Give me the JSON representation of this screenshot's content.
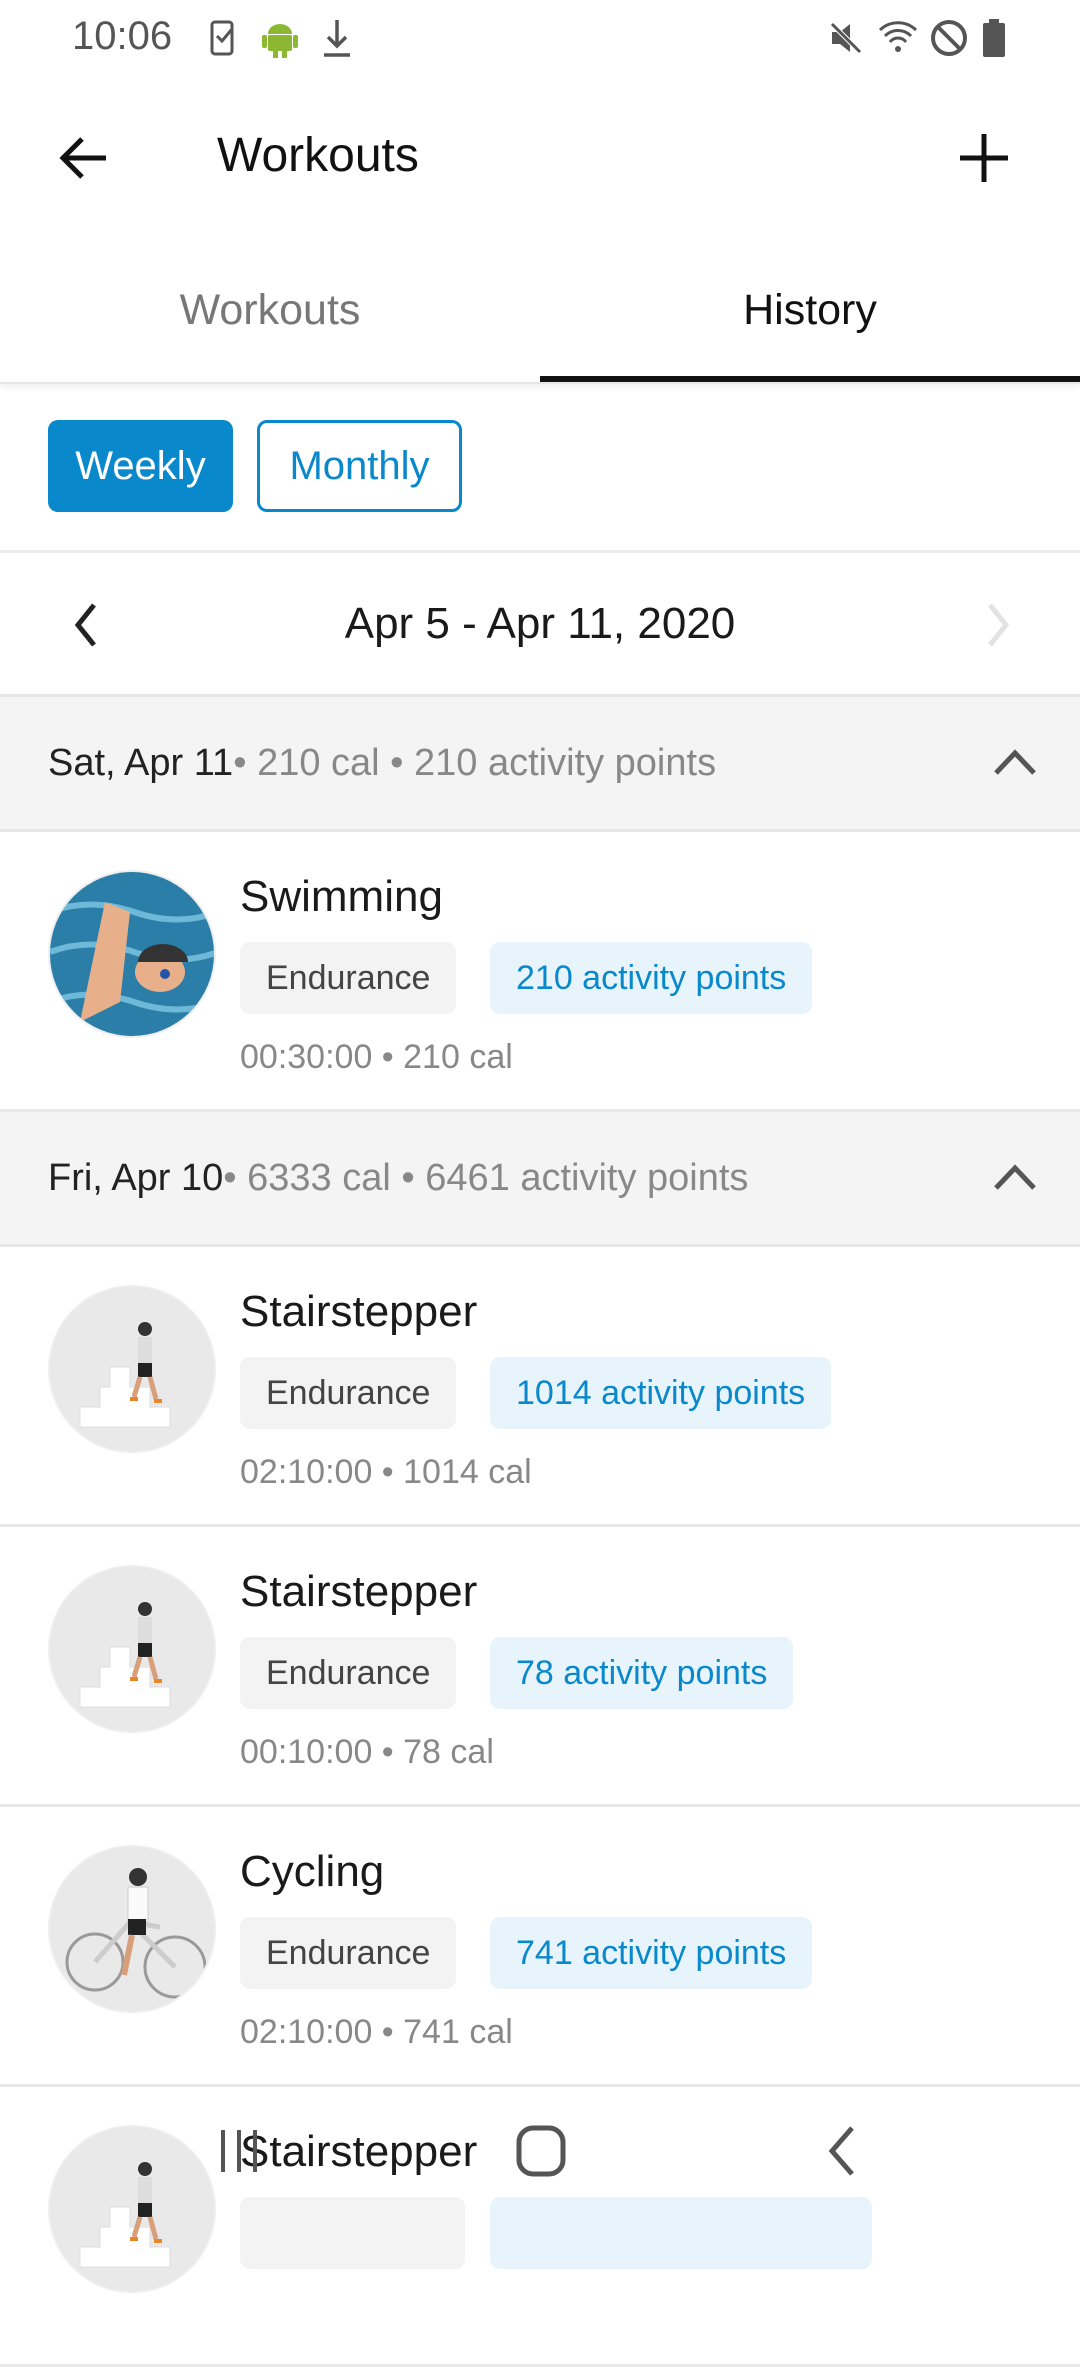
{
  "status_bar": {
    "time": "10:06",
    "icons": [
      "task-check-icon",
      "android-icon",
      "download-icon",
      "mute-icon",
      "wifi-icon",
      "do-not-disturb-icon",
      "battery-icon"
    ]
  },
  "toolbar": {
    "title": "Workouts",
    "back_icon": "arrow-left-icon",
    "add_icon": "plus-icon"
  },
  "tabs": [
    {
      "label": "Workouts",
      "active": false
    },
    {
      "label": "History",
      "active": true
    }
  ],
  "period": {
    "options": [
      "Weekly",
      "Monthly"
    ],
    "selected": "Weekly"
  },
  "date_range": {
    "label": "Apr 5 - Apr 11, 2020",
    "next_enabled": false
  },
  "colors": {
    "accent": "#0a88cc",
    "chip_bg": "#e8f4fb"
  },
  "days": [
    {
      "date": "Sat, Apr 11",
      "summary": " • 210 cal • 210 activity points",
      "items": [
        {
          "name": "Swimming",
          "type": "Endurance",
          "points": "210 activity points",
          "detail": "00:30:00 • 210 cal",
          "image": "swimming"
        }
      ]
    },
    {
      "date": "Fri, Apr 10",
      "summary": " • 6333 cal • 6461 activity points",
      "items": [
        {
          "name": "Stairstepper",
          "type": "Endurance",
          "points": "1014 activity points",
          "detail": "02:10:00 • 1014 cal",
          "image": "stairs"
        },
        {
          "name": "Stairstepper",
          "type": "Endurance",
          "points": "78 activity points",
          "detail": "00:10:00 • 78 cal",
          "image": "stairs"
        },
        {
          "name": "Cycling",
          "type": "Endurance",
          "points": "741 activity points",
          "detail": "02:10:00 • 741 cal",
          "image": "cycling"
        },
        {
          "name": "Stairstepper",
          "type": "",
          "points": "",
          "detail": "",
          "image": "stairs"
        }
      ]
    }
  ]
}
